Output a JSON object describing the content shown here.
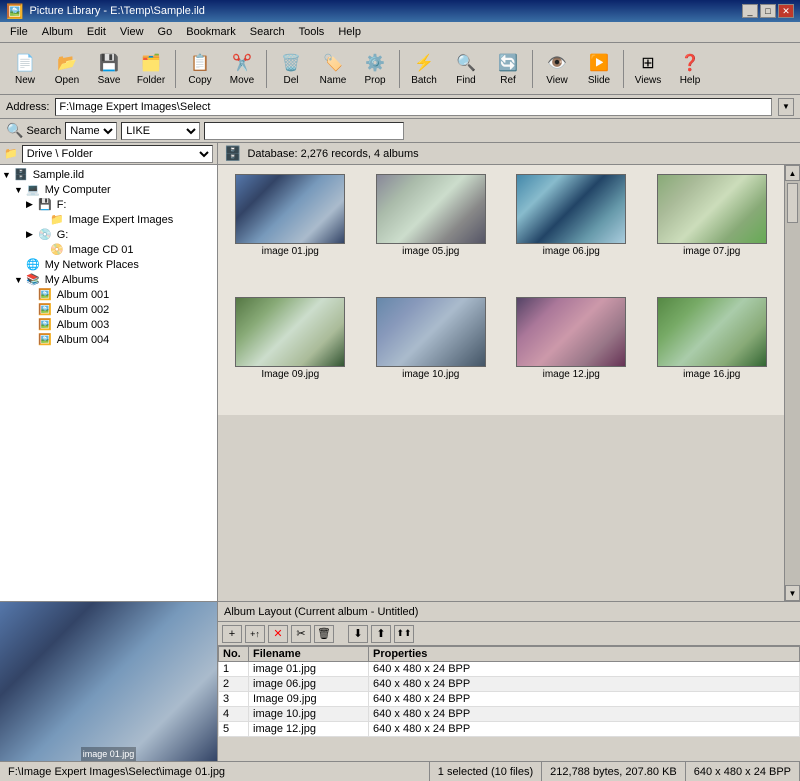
{
  "titlebar": {
    "title": "Picture Library - E:\\Temp\\Sample.ild",
    "controls": [
      "_",
      "□",
      "✕"
    ]
  },
  "menubar": {
    "items": [
      "File",
      "Album",
      "Edit",
      "View",
      "Go",
      "Bookmark",
      "Search",
      "Tools",
      "Help"
    ]
  },
  "toolbar": {
    "buttons": [
      {
        "label": "New",
        "icon": "📄",
        "name": "new-button"
      },
      {
        "label": "Open",
        "icon": "📂",
        "name": "open-button"
      },
      {
        "label": "Save",
        "icon": "💾",
        "name": "save-button"
      },
      {
        "label": "Folder",
        "icon": "🗂️",
        "name": "folder-button"
      },
      {
        "label": "Copy",
        "icon": "📋",
        "name": "copy-button"
      },
      {
        "label": "Move",
        "icon": "✂️",
        "name": "move-button"
      },
      {
        "label": "Del",
        "icon": "🗑️",
        "name": "del-button"
      },
      {
        "label": "Name",
        "icon": "🏷️",
        "name": "name-button"
      },
      {
        "label": "Prop",
        "icon": "⚙️",
        "name": "prop-button"
      },
      {
        "label": "Batch",
        "icon": "⚡",
        "name": "batch-button"
      },
      {
        "label": "Find",
        "icon": "🔍",
        "name": "find-button"
      },
      {
        "label": "Ref",
        "icon": "🔄",
        "name": "ref-button"
      },
      {
        "label": "View",
        "icon": "👁️",
        "name": "view-button"
      },
      {
        "label": "Slide",
        "icon": "▶️",
        "name": "slide-button"
      },
      {
        "label": "Views",
        "icon": "⊞",
        "name": "views-button"
      },
      {
        "label": "Help",
        "icon": "❓",
        "name": "help-button"
      }
    ]
  },
  "addressbar": {
    "label": "Address:",
    "value": "F:\\Image Expert Images\\Select"
  },
  "searchbar": {
    "label": "Search",
    "field_option": "Name",
    "operator": "LIKE",
    "placeholder": ""
  },
  "left_panel": {
    "dropdown_label": "Drive \\ Folder",
    "tree": [
      {
        "label": "Sample.ild",
        "indent": 0,
        "icon": "🗄️",
        "expandable": true
      },
      {
        "label": "My Computer",
        "indent": 1,
        "icon": "💻",
        "expandable": true
      },
      {
        "label": "F:",
        "indent": 2,
        "icon": "💾",
        "expandable": true
      },
      {
        "label": "Image Expert Images",
        "indent": 3,
        "icon": "📁",
        "expandable": false
      },
      {
        "label": "G:",
        "indent": 2,
        "icon": "💿",
        "expandable": true
      },
      {
        "label": "Image CD 01",
        "indent": 3,
        "icon": "📀",
        "expandable": false
      },
      {
        "label": "My Network Places",
        "indent": 1,
        "icon": "🌐",
        "expandable": false
      },
      {
        "label": "My Albums",
        "indent": 1,
        "icon": "📚",
        "expandable": true
      },
      {
        "label": "Album 001",
        "indent": 2,
        "icon": "🖼️",
        "expandable": false
      },
      {
        "label": "Album 002",
        "indent": 2,
        "icon": "🖼️",
        "expandable": false
      },
      {
        "label": "Album 003",
        "indent": 2,
        "icon": "🖼️",
        "expandable": false
      },
      {
        "label": "Album 004",
        "indent": 2,
        "icon": "🖼️",
        "expandable": false
      }
    ]
  },
  "right_panel": {
    "db_header": "Database: 2,276 records, 4 albums",
    "thumbnails": [
      {
        "label": "image 01.jpg",
        "class": "img-01"
      },
      {
        "label": "image 05.jpg",
        "class": "img-05"
      },
      {
        "label": "image 06.jpg",
        "class": "img-06"
      },
      {
        "label": "image 07.jpg",
        "class": "img-07"
      },
      {
        "label": "Image 09.jpg",
        "class": "img-09"
      },
      {
        "label": "image 10.jpg",
        "class": "img-10"
      },
      {
        "label": "image 12.jpg",
        "class": "img-12"
      },
      {
        "label": "image 16.jpg",
        "class": "img-16"
      }
    ]
  },
  "album_panel": {
    "header": "Album Layout (Current album - Untitled)",
    "toolbar_buttons": [
      "+",
      "+",
      "✕",
      "✂️",
      "🗑️",
      "⬇",
      "⬆",
      "⬆"
    ],
    "columns": [
      "No.",
      "Filename",
      "Properties"
    ],
    "rows": [
      {
        "no": "1",
        "filename": "image 01.jpg",
        "properties": "640 x 480 x 24 BPP"
      },
      {
        "no": "2",
        "filename": "image 06.jpg",
        "properties": "640 x 480 x 24 BPP"
      },
      {
        "no": "3",
        "filename": "Image 09.jpg",
        "properties": "640 x 480 x 24 BPP"
      },
      {
        "no": "4",
        "filename": "image 10.jpg",
        "properties": "640 x 480 x 24 BPP"
      },
      {
        "no": "5",
        "filename": "image 12.jpg",
        "properties": "640 x 480 x 24 BPP"
      }
    ]
  },
  "statusbar": {
    "path": "F:\\Image Expert Images\\Select\\image 01.jpg",
    "selected": "1 selected (10 files)",
    "size": "212,788 bytes, 207.80 KB",
    "dimensions": "640 x 480 x 24 BPP"
  }
}
